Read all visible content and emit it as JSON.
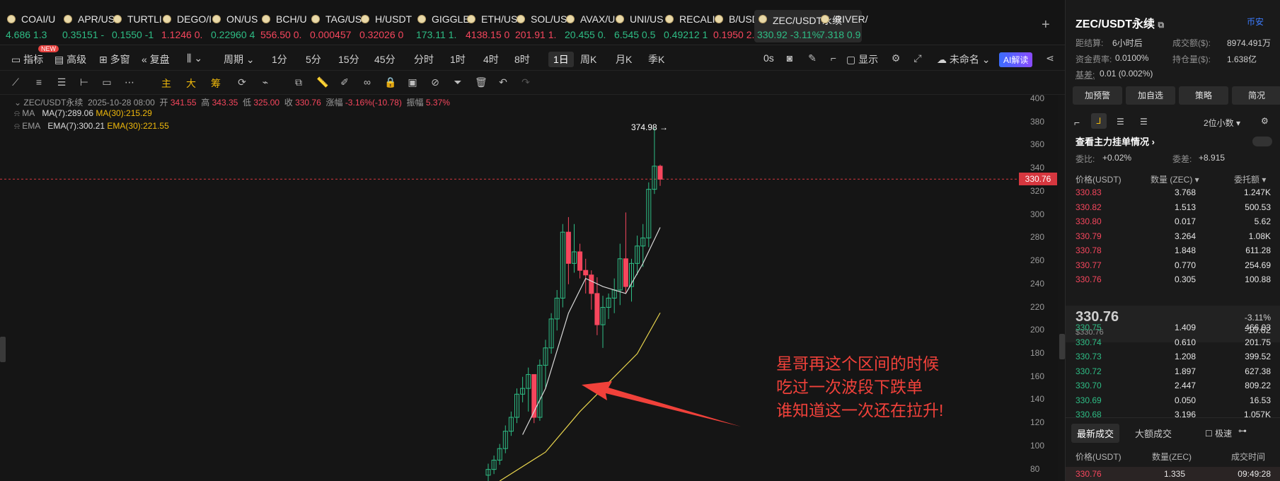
{
  "tabs": [
    {
      "sym": "COAI/U",
      "price": "4.686 1.3",
      "dir": "up"
    },
    {
      "sym": "APR/US",
      "price": "0.35151 -",
      "dir": "up"
    },
    {
      "sym": "TURTLI",
      "price": "0.1550 -1",
      "dir": "up"
    },
    {
      "sym": "DEGO/I",
      "price": "1.1246 0.",
      "dir": "dn"
    },
    {
      "sym": "ON/US",
      "price": "0.22960 4",
      "dir": "up"
    },
    {
      "sym": "BCH/U",
      "price": "556.50 0.",
      "dir": "dn"
    },
    {
      "sym": "TAG/US",
      "price": "0.000457",
      "dir": "dn"
    },
    {
      "sym": "H/USDT",
      "price": "0.32026 0",
      "dir": "dn"
    },
    {
      "sym": "GIGGLE",
      "price": "173.11 1.",
      "dir": "up"
    },
    {
      "sym": "ETH/US",
      "price": "4138.15 0",
      "dir": "dn"
    },
    {
      "sym": "SOL/US",
      "price": "201.91 1.",
      "dir": "dn"
    },
    {
      "sym": "AVAX/U",
      "price": "20.455 0.",
      "dir": "up"
    },
    {
      "sym": "UNI/US",
      "price": "6.545 0.5",
      "dir": "up"
    },
    {
      "sym": "RECALI",
      "price": "0.49212 1",
      "dir": "up"
    },
    {
      "sym": "B/USDT",
      "price": "0.1950 2.",
      "dir": "dn"
    },
    {
      "sym": "ZEC/USDT永续",
      "price": "330.92 -3.11%",
      "dir": "up"
    },
    {
      "sym": "RIVER/",
      "price": "7.318 0.9",
      "dir": "up"
    }
  ],
  "toolbar": {
    "indicator": "指标",
    "advanced": "高级",
    "multi": "多窗",
    "review": "复盘",
    "period": "周期",
    "new_badge": "NEW",
    "intervals": [
      "1分",
      "5分",
      "15分",
      "45分",
      "分时",
      "1时",
      "4时",
      "8时",
      "1日",
      "周K",
      "月K",
      "季K"
    ],
    "countdown": "0s",
    "display": "显示",
    "unnamed": "未命名",
    "ai": "AI解读",
    "main": "主",
    "big": "大",
    "chip": "筹"
  },
  "chart": {
    "pair": "ZEC/USDT永续",
    "date": "2025-10-28 08:00",
    "open_label": "开",
    "open": "341.55",
    "high_label": "高",
    "high": "343.35",
    "low_label": "低",
    "low": "325.00",
    "close_label": "收",
    "close": "330.76",
    "chg_label": "涨幅",
    "chg": "-3.16%(-10.78)",
    "amp_label": "振幅",
    "amp": "5.37%",
    "ma_label": "MA",
    "ma7": "MA(7):289.06",
    "ma30": "MA(30):215.29",
    "ema_label": "EMA",
    "ema7": "EMA(7):300.21",
    "ema30": "EMA(30):221.55",
    "high_mark": "374.98",
    "current": "330.76",
    "annotation": [
      "星哥再这个区间的时候",
      "吃过一次波段下跌单",
      "谁知道这一次还在拉升!"
    ]
  },
  "chart_data": {
    "type": "candlestick",
    "title": "ZEC/USDT永续 1日",
    "yticks": [
      80,
      100,
      120,
      140,
      160,
      180,
      200,
      220,
      240,
      260,
      280,
      300,
      320,
      340,
      360,
      380,
      400
    ],
    "ylim": [
      70,
      400
    ],
    "candles": [
      {
        "o": 75,
        "h": 85,
        "l": 70,
        "c": 80
      },
      {
        "o": 80,
        "h": 92,
        "l": 76,
        "c": 88
      },
      {
        "o": 88,
        "h": 102,
        "l": 84,
        "c": 98
      },
      {
        "o": 98,
        "h": 118,
        "l": 94,
        "c": 113
      },
      {
        "o": 113,
        "h": 130,
        "l": 109,
        "c": 125
      },
      {
        "o": 125,
        "h": 150,
        "l": 120,
        "c": 145
      },
      {
        "o": 145,
        "h": 160,
        "l": 138,
        "c": 150
      },
      {
        "o": 150,
        "h": 168,
        "l": 130,
        "c": 162
      },
      {
        "o": 162,
        "h": 160,
        "l": 120,
        "c": 125
      },
      {
        "o": 125,
        "h": 175,
        "l": 122,
        "c": 170
      },
      {
        "o": 170,
        "h": 192,
        "l": 150,
        "c": 185
      },
      {
        "o": 185,
        "h": 215,
        "l": 180,
        "c": 210
      },
      {
        "o": 210,
        "h": 235,
        "l": 200,
        "c": 228
      },
      {
        "o": 228,
        "h": 292,
        "l": 220,
        "c": 285
      },
      {
        "o": 285,
        "h": 298,
        "l": 240,
        "c": 258
      },
      {
        "o": 258,
        "h": 292,
        "l": 250,
        "c": 268
      },
      {
        "o": 268,
        "h": 275,
        "l": 245,
        "c": 252
      },
      {
        "o": 252,
        "h": 262,
        "l": 232,
        "c": 248
      },
      {
        "o": 248,
        "h": 252,
        "l": 218,
        "c": 232
      },
      {
        "o": 232,
        "h": 246,
        "l": 196,
        "c": 205
      },
      {
        "o": 205,
        "h": 230,
        "l": 185,
        "c": 220
      },
      {
        "o": 220,
        "h": 232,
        "l": 210,
        "c": 228
      },
      {
        "o": 228,
        "h": 245,
        "l": 215,
        "c": 235
      },
      {
        "o": 235,
        "h": 275,
        "l": 222,
        "c": 262
      },
      {
        "o": 262,
        "h": 302,
        "l": 232,
        "c": 238
      },
      {
        "o": 238,
        "h": 262,
        "l": 225,
        "c": 258
      },
      {
        "o": 258,
        "h": 282,
        "l": 248,
        "c": 273
      },
      {
        "o": 273,
        "h": 292,
        "l": 255,
        "c": 280
      },
      {
        "o": 280,
        "h": 328,
        "l": 272,
        "c": 322
      },
      {
        "o": 322,
        "h": 375,
        "l": 318,
        "c": 342
      },
      {
        "o": 342,
        "h": 343.35,
        "l": 325,
        "c": 330.76
      }
    ],
    "ma7": [
      {
        "i": 6,
        "v": 110
      },
      {
        "i": 10,
        "v": 150
      },
      {
        "i": 14,
        "v": 215
      },
      {
        "i": 17,
        "v": 245
      },
      {
        "i": 20,
        "v": 238
      },
      {
        "i": 24,
        "v": 232
      },
      {
        "i": 27,
        "v": 258
      },
      {
        "i": 30,
        "v": 289.06
      }
    ],
    "ma30": [
      {
        "i": 2,
        "v": 70
      },
      {
        "i": 10,
        "v": 95
      },
      {
        "i": 16,
        "v": 130
      },
      {
        "i": 22,
        "v": 160
      },
      {
        "i": 26,
        "v": 180
      },
      {
        "i": 30,
        "v": 215.29
      }
    ]
  },
  "side": {
    "title": "ZEC/USDT永续",
    "safe": "币安",
    "settle_label": "距结算:",
    "settle": "6小时后",
    "vol_label": "成交额($):",
    "vol": "8974.491万",
    "fund_label": "资金费率:",
    "fund": "0.0100%",
    "oi_label": "持仓量($):",
    "oi": "1.638亿",
    "basis_label": "基差:",
    "basis": "0.01 (0.002%)",
    "buttons": [
      "加预警",
      "加自选",
      "策略",
      "简况"
    ],
    "decimals": "2位小数",
    "main_orders": "查看主力挂单情况",
    "ratio_label": "委比:",
    "ratio": "+0.02%",
    "diff_label": "委差:",
    "diff": "+8.915",
    "cols": [
      "价格(USDT)",
      "数量 (ZEC)",
      "委托额"
    ],
    "asks": [
      [
        "330.83",
        "3.768",
        "1.247K"
      ],
      [
        "330.82",
        "1.513",
        "500.53"
      ],
      [
        "330.80",
        "0.017",
        "5.62"
      ],
      [
        "330.79",
        "3.264",
        "1.08K"
      ],
      [
        "330.78",
        "1.848",
        "611.28"
      ],
      [
        "330.77",
        "0.770",
        "254.69"
      ],
      [
        "330.76",
        "0.305",
        "100.88"
      ]
    ],
    "last": "330.76",
    "last_usd": "$330.76",
    "last_pct": "-3.11%",
    "last_chg": "-10.62",
    "bids": [
      [
        "330.75",
        "1.409",
        "466.03"
      ],
      [
        "330.74",
        "0.610",
        "201.75"
      ],
      [
        "330.73",
        "1.208",
        "399.52"
      ],
      [
        "330.72",
        "1.897",
        "627.38"
      ],
      [
        "330.70",
        "2.447",
        "809.22"
      ],
      [
        "330.69",
        "0.050",
        "16.53"
      ],
      [
        "330.68",
        "3.196",
        "1.057K"
      ]
    ],
    "trade_tabs": [
      "最新成交",
      "大额成交"
    ],
    "fast": "极速",
    "trade_cols": [
      "价格(USDT)",
      "数量(ZEC)",
      "成交时间"
    ],
    "trade": [
      "330.76",
      "1.335",
      "09:49:28"
    ]
  }
}
